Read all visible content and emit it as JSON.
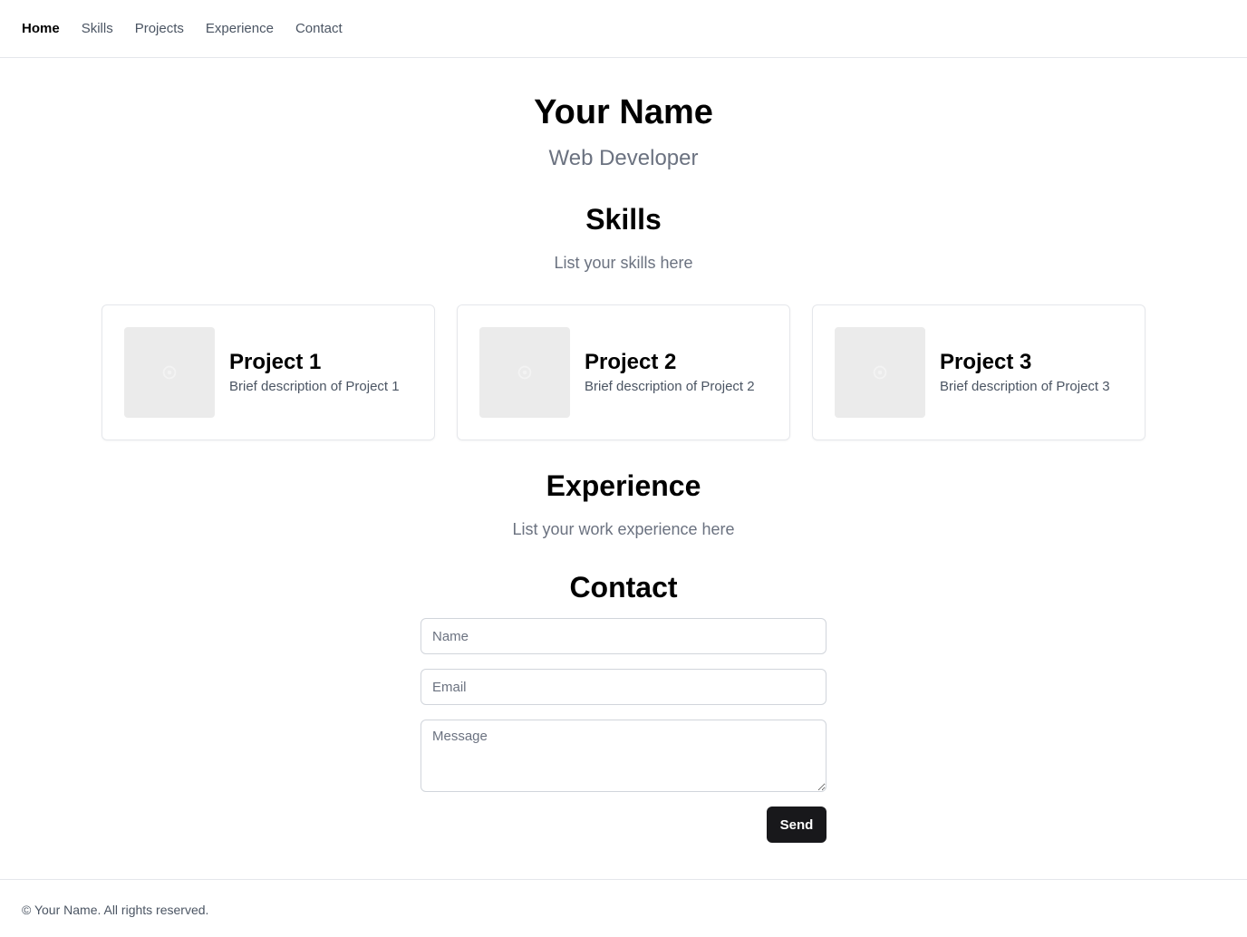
{
  "nav": {
    "items": [
      {
        "label": "Home",
        "active": true
      },
      {
        "label": "Skills",
        "active": false
      },
      {
        "label": "Projects",
        "active": false
      },
      {
        "label": "Experience",
        "active": false
      },
      {
        "label": "Contact",
        "active": false
      }
    ]
  },
  "hero": {
    "name": "Your Name",
    "role": "Web Developer"
  },
  "skills": {
    "title": "Skills",
    "subtitle": "List your skills here"
  },
  "projects": {
    "items": [
      {
        "title": "Project 1",
        "description": "Brief description of Project 1",
        "icon": "image-placeholder-icon"
      },
      {
        "title": "Project 2",
        "description": "Brief description of Project 2",
        "icon": "image-placeholder-icon"
      },
      {
        "title": "Project 3",
        "description": "Brief description of Project 3",
        "icon": "image-placeholder-icon"
      }
    ]
  },
  "experience": {
    "title": "Experience",
    "subtitle": "List your work experience here"
  },
  "contact": {
    "title": "Contact",
    "name_placeholder": "Name",
    "email_placeholder": "Email",
    "message_placeholder": "Message",
    "send_label": "Send"
  },
  "footer": {
    "text": "© Your Name. All rights reserved."
  },
  "colors": {
    "primary_button": "#18181b",
    "muted_text": "#6b7280",
    "border": "#e5e7eb"
  }
}
